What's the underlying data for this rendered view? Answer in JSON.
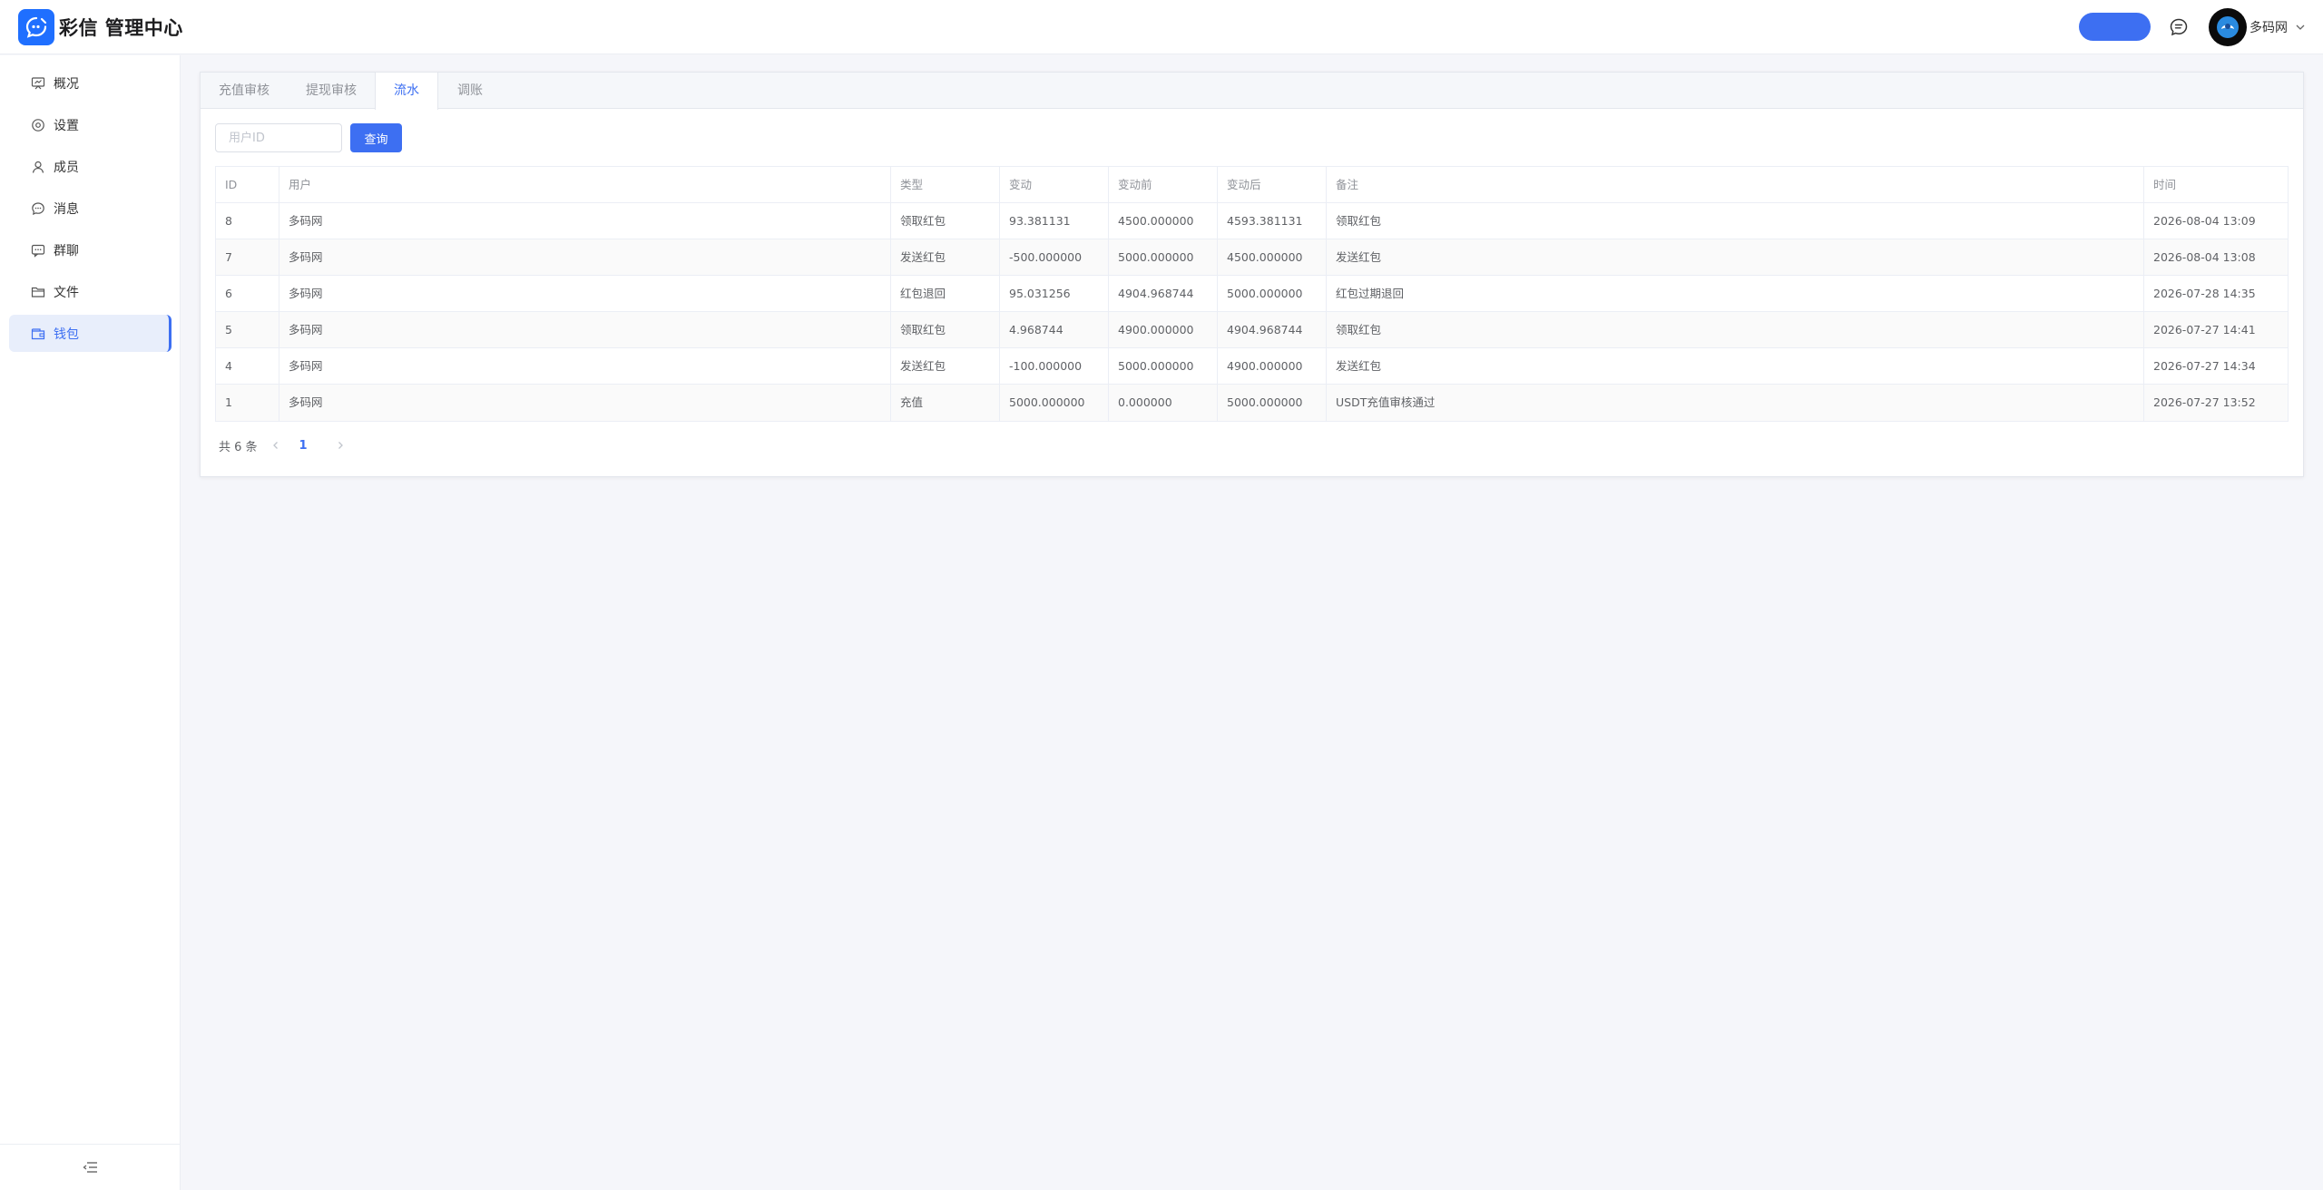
{
  "app": {
    "brand": "彩信 管理中心"
  },
  "header": {
    "user_name": "多码网"
  },
  "sidebar": {
    "items": [
      {
        "label": "概况",
        "icon": "dashboard-icon"
      },
      {
        "label": "设置",
        "icon": "gear-icon"
      },
      {
        "label": "成员",
        "icon": "user-icon"
      },
      {
        "label": "消息",
        "icon": "chat-icon"
      },
      {
        "label": "群聊",
        "icon": "group-chat-icon"
      },
      {
        "label": "文件",
        "icon": "folder-icon"
      },
      {
        "label": "钱包",
        "icon": "wallet-icon",
        "active": true
      }
    ]
  },
  "tabs": [
    {
      "label": "充值审核"
    },
    {
      "label": "提现审核"
    },
    {
      "label": "流水",
      "active": true
    },
    {
      "label": "调账"
    }
  ],
  "search": {
    "placeholder": "用户ID",
    "button_label": "查询"
  },
  "table": {
    "columns": [
      "ID",
      "用户",
      "类型",
      "变动",
      "变动前",
      "变动后",
      "备注",
      "时间"
    ],
    "rows": [
      [
        "8",
        "多码网",
        "领取红包",
        "93.381131",
        "4500.000000",
        "4593.381131",
        "领取红包",
        "2026-08-04 13:09"
      ],
      [
        "7",
        "多码网",
        "发送红包",
        "-500.000000",
        "5000.000000",
        "4500.000000",
        "发送红包",
        "2026-08-04 13:08"
      ],
      [
        "6",
        "多码网",
        "红包退回",
        "95.031256",
        "4904.968744",
        "5000.000000",
        "红包过期退回",
        "2026-07-28 14:35"
      ],
      [
        "5",
        "多码网",
        "领取红包",
        "4.968744",
        "4900.000000",
        "4904.968744",
        "领取红包",
        "2026-07-27 14:41"
      ],
      [
        "4",
        "多码网",
        "发送红包",
        "-100.000000",
        "5000.000000",
        "4900.000000",
        "发送红包",
        "2026-07-27 14:34"
      ],
      [
        "1",
        "多码网",
        "充值",
        "5000.000000",
        "0.000000",
        "5000.000000",
        "USDT充值审核通过",
        "2026-07-27 13:52"
      ]
    ]
  },
  "pagination": {
    "total_text": "共 6 条",
    "current_page": "1"
  },
  "colors": {
    "accent": "#3d6ff2",
    "logo": "#1f6fff",
    "active_nav_bg": "#e8eefb"
  }
}
